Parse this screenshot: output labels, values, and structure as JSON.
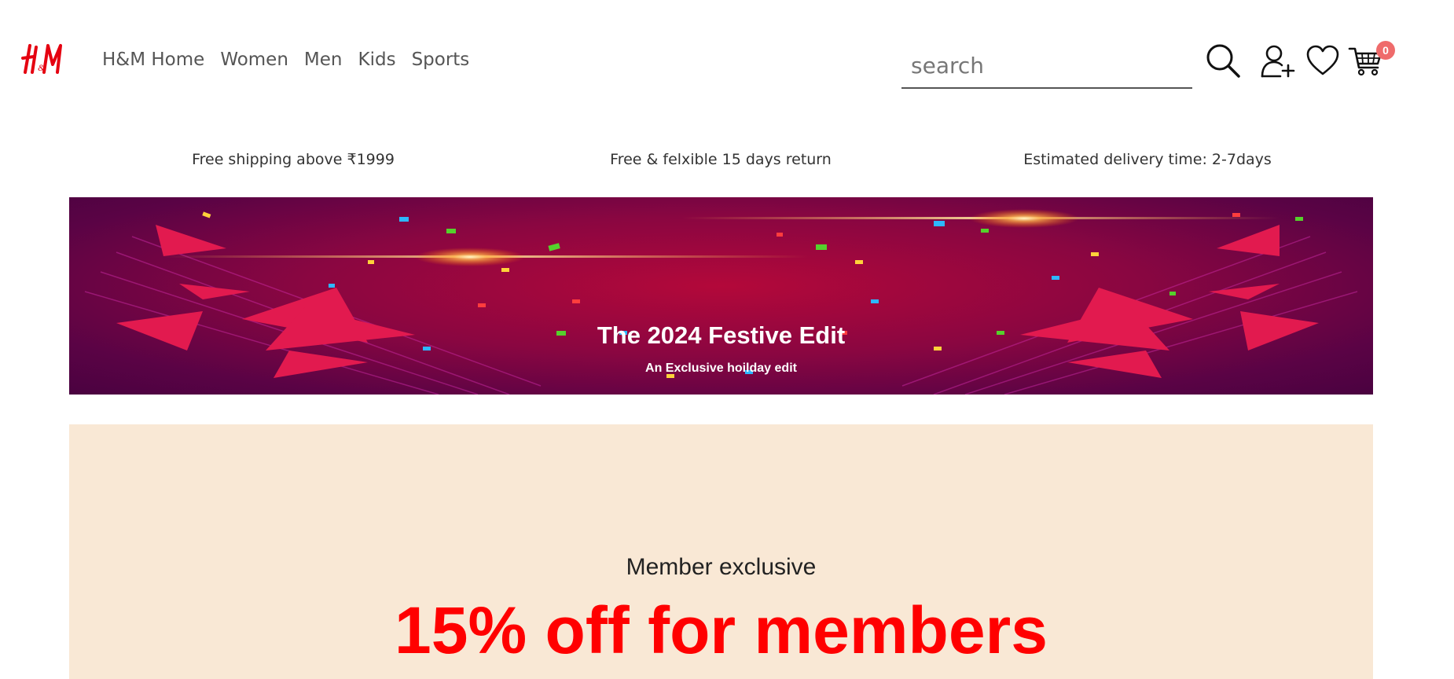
{
  "header": {
    "logo_text": "H&M",
    "nav": [
      {
        "label": "H&M Home"
      },
      {
        "label": "Women"
      },
      {
        "label": "Men"
      },
      {
        "label": "Kids"
      },
      {
        "label": "Sports"
      }
    ],
    "search": {
      "placeholder": "search",
      "value": ""
    },
    "cart_count": "0",
    "icons": [
      "search-icon",
      "add-user-icon",
      "heart-icon",
      "cart-icon"
    ]
  },
  "info_strip": [
    {
      "text": "Free shipping above ₹1999"
    },
    {
      "text": "Free & felxible 15 days return"
    },
    {
      "text": "Estimated delivery time: 2-7days"
    }
  ],
  "banner": {
    "title": "The 2024 Festive Edit",
    "subtitle": "An Exclusive hoilday edit"
  },
  "member": {
    "kicker": "Member exclusive",
    "headline": "15% off for members"
  },
  "colors": {
    "brand_red": "#e50010",
    "badge": "#ef6b6b",
    "headline_red": "#ff0000",
    "member_bg": "#f9e8d5",
    "banner_base": "#8a0641"
  }
}
